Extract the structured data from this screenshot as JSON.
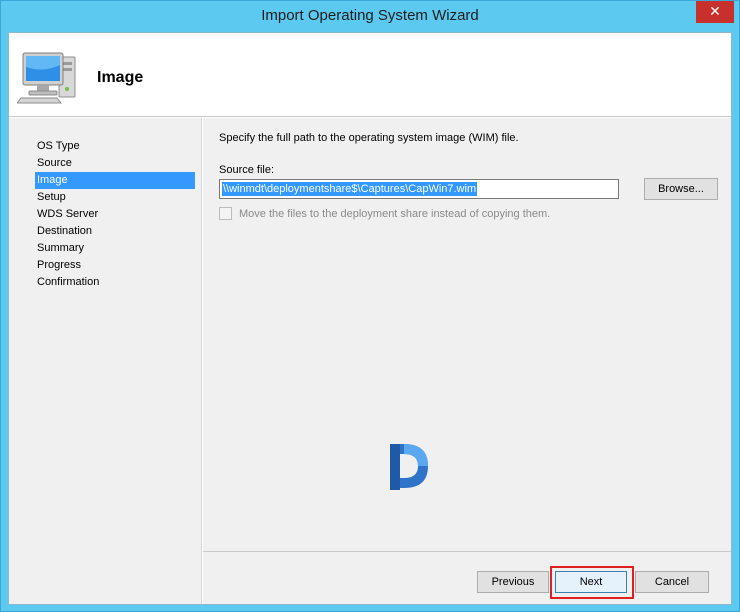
{
  "window": {
    "title": "Import Operating System Wizard",
    "close_glyph": "✕"
  },
  "header": {
    "title": "Image",
    "icon": "computer-icon"
  },
  "nav": {
    "items": [
      {
        "label": "OS Type"
      },
      {
        "label": "Source"
      },
      {
        "label": "Image",
        "selected": true
      },
      {
        "label": "Setup"
      },
      {
        "label": "WDS Server"
      },
      {
        "label": "Destination"
      },
      {
        "label": "Summary"
      },
      {
        "label": "Progress"
      },
      {
        "label": "Confirmation"
      }
    ]
  },
  "content": {
    "instruction": "Specify the full path to the operating system image (WIM) file.",
    "source_label": "Source file:",
    "source_value": "\\\\winmdt\\deploymentshare$\\Captures\\CapWin7.wim",
    "browse_label": "Browse...",
    "move_files_label": "Move the files to the deployment share instead of copying them.",
    "move_files_checked": false
  },
  "footer": {
    "previous_label": "Previous",
    "next_label": "Next",
    "cancel_label": "Cancel"
  },
  "colors": {
    "title_bar": "#5ccaf0",
    "close": "#c7302b",
    "selection": "#3399ff",
    "highlight": "#e02020"
  }
}
